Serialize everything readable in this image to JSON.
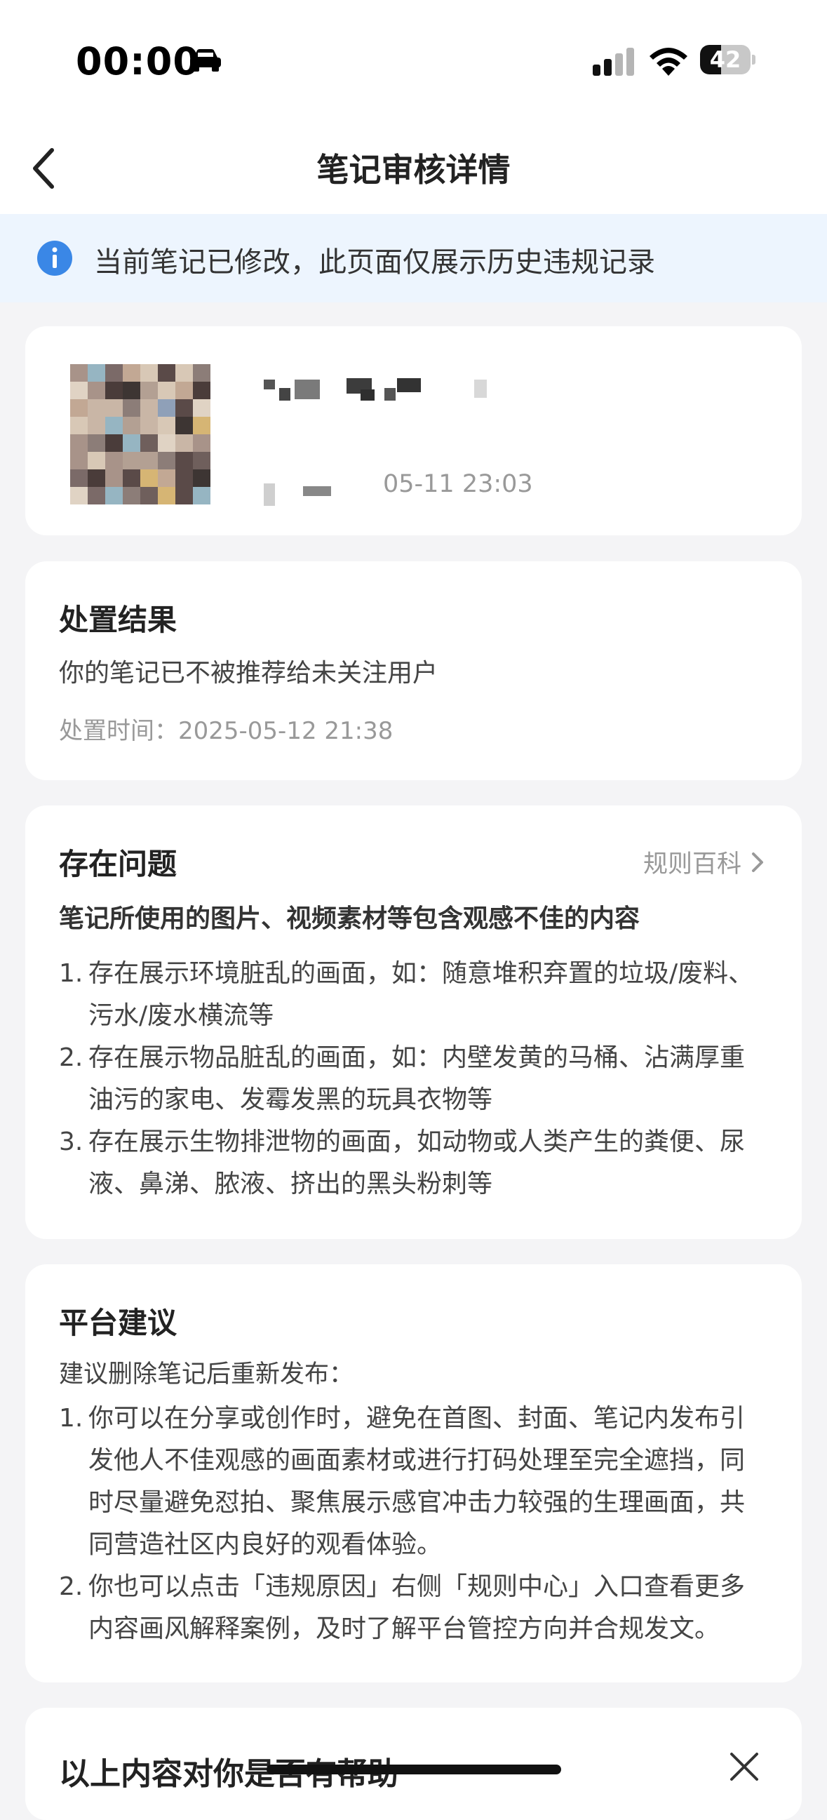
{
  "status_bar": {
    "time": "00:00",
    "battery": "42",
    "battery_level": 0.42,
    "icons": [
      "car-icon",
      "cellular-signal-icon",
      "wifi-icon",
      "battery-icon"
    ]
  },
  "nav": {
    "title": "笔记审核详情",
    "back_icon": "chevron-left-icon"
  },
  "notice": {
    "icon": "info-icon",
    "text": "当前笔记已修改，此页面仅展示历史违规记录"
  },
  "note": {
    "thumbnail": "pixelated-image",
    "title": "",
    "time": "05-11 23:03"
  },
  "result": {
    "title": "处置结果",
    "text": "你的笔记已不被推荐给未关注用户",
    "time_label": "处置时间：",
    "time": "2025-05-12 21:38"
  },
  "issue": {
    "title": "存在问题",
    "link": "规则百科",
    "summary": "笔记所使用的图片、视频素材等包含观感不佳的内容",
    "items": [
      {
        "num": "1.",
        "text": "存在展示环境脏乱的画面，如：随意堆积弃置的垃圾/废料、污水/废水横流等"
      },
      {
        "num": "2.",
        "text": "存在展示物品脏乱的画面，如：内壁发黄的马桶、沾满厚重油污的家电、发霉发黑的玩具衣物等"
      },
      {
        "num": "3.",
        "text": "存在展示生物排泄物的画面，如动物或人类产生的粪便、尿液、鼻涕、脓液、挤出的黑头粉刺等"
      }
    ]
  },
  "advice": {
    "title": "平台建议",
    "intro": "建议删除笔记后重新发布：",
    "items": [
      {
        "num": "1.",
        "text": "你可以在分享或创作时，避免在首图、封面、笔记内发布引发他人不佳观感的画面素材或进行打码处理至完全遮挡，同时尽量避免怼拍、聚焦展示感官冲击力较强的生理画面，共同营造社区内良好的观看体验。"
      },
      {
        "num": "2.",
        "text": "你也可以点击「违规原因」右侧「规则中心」入口查看更多内容画风解释案例，及时了解平台管控方向并合规发文。"
      }
    ]
  },
  "feedback": {
    "title": "以上内容对你是否有帮助"
  },
  "colors": {
    "accent": "#3a87e6",
    "notice_bg": "#edf5fe",
    "page_bg": "#f4f4f6"
  }
}
